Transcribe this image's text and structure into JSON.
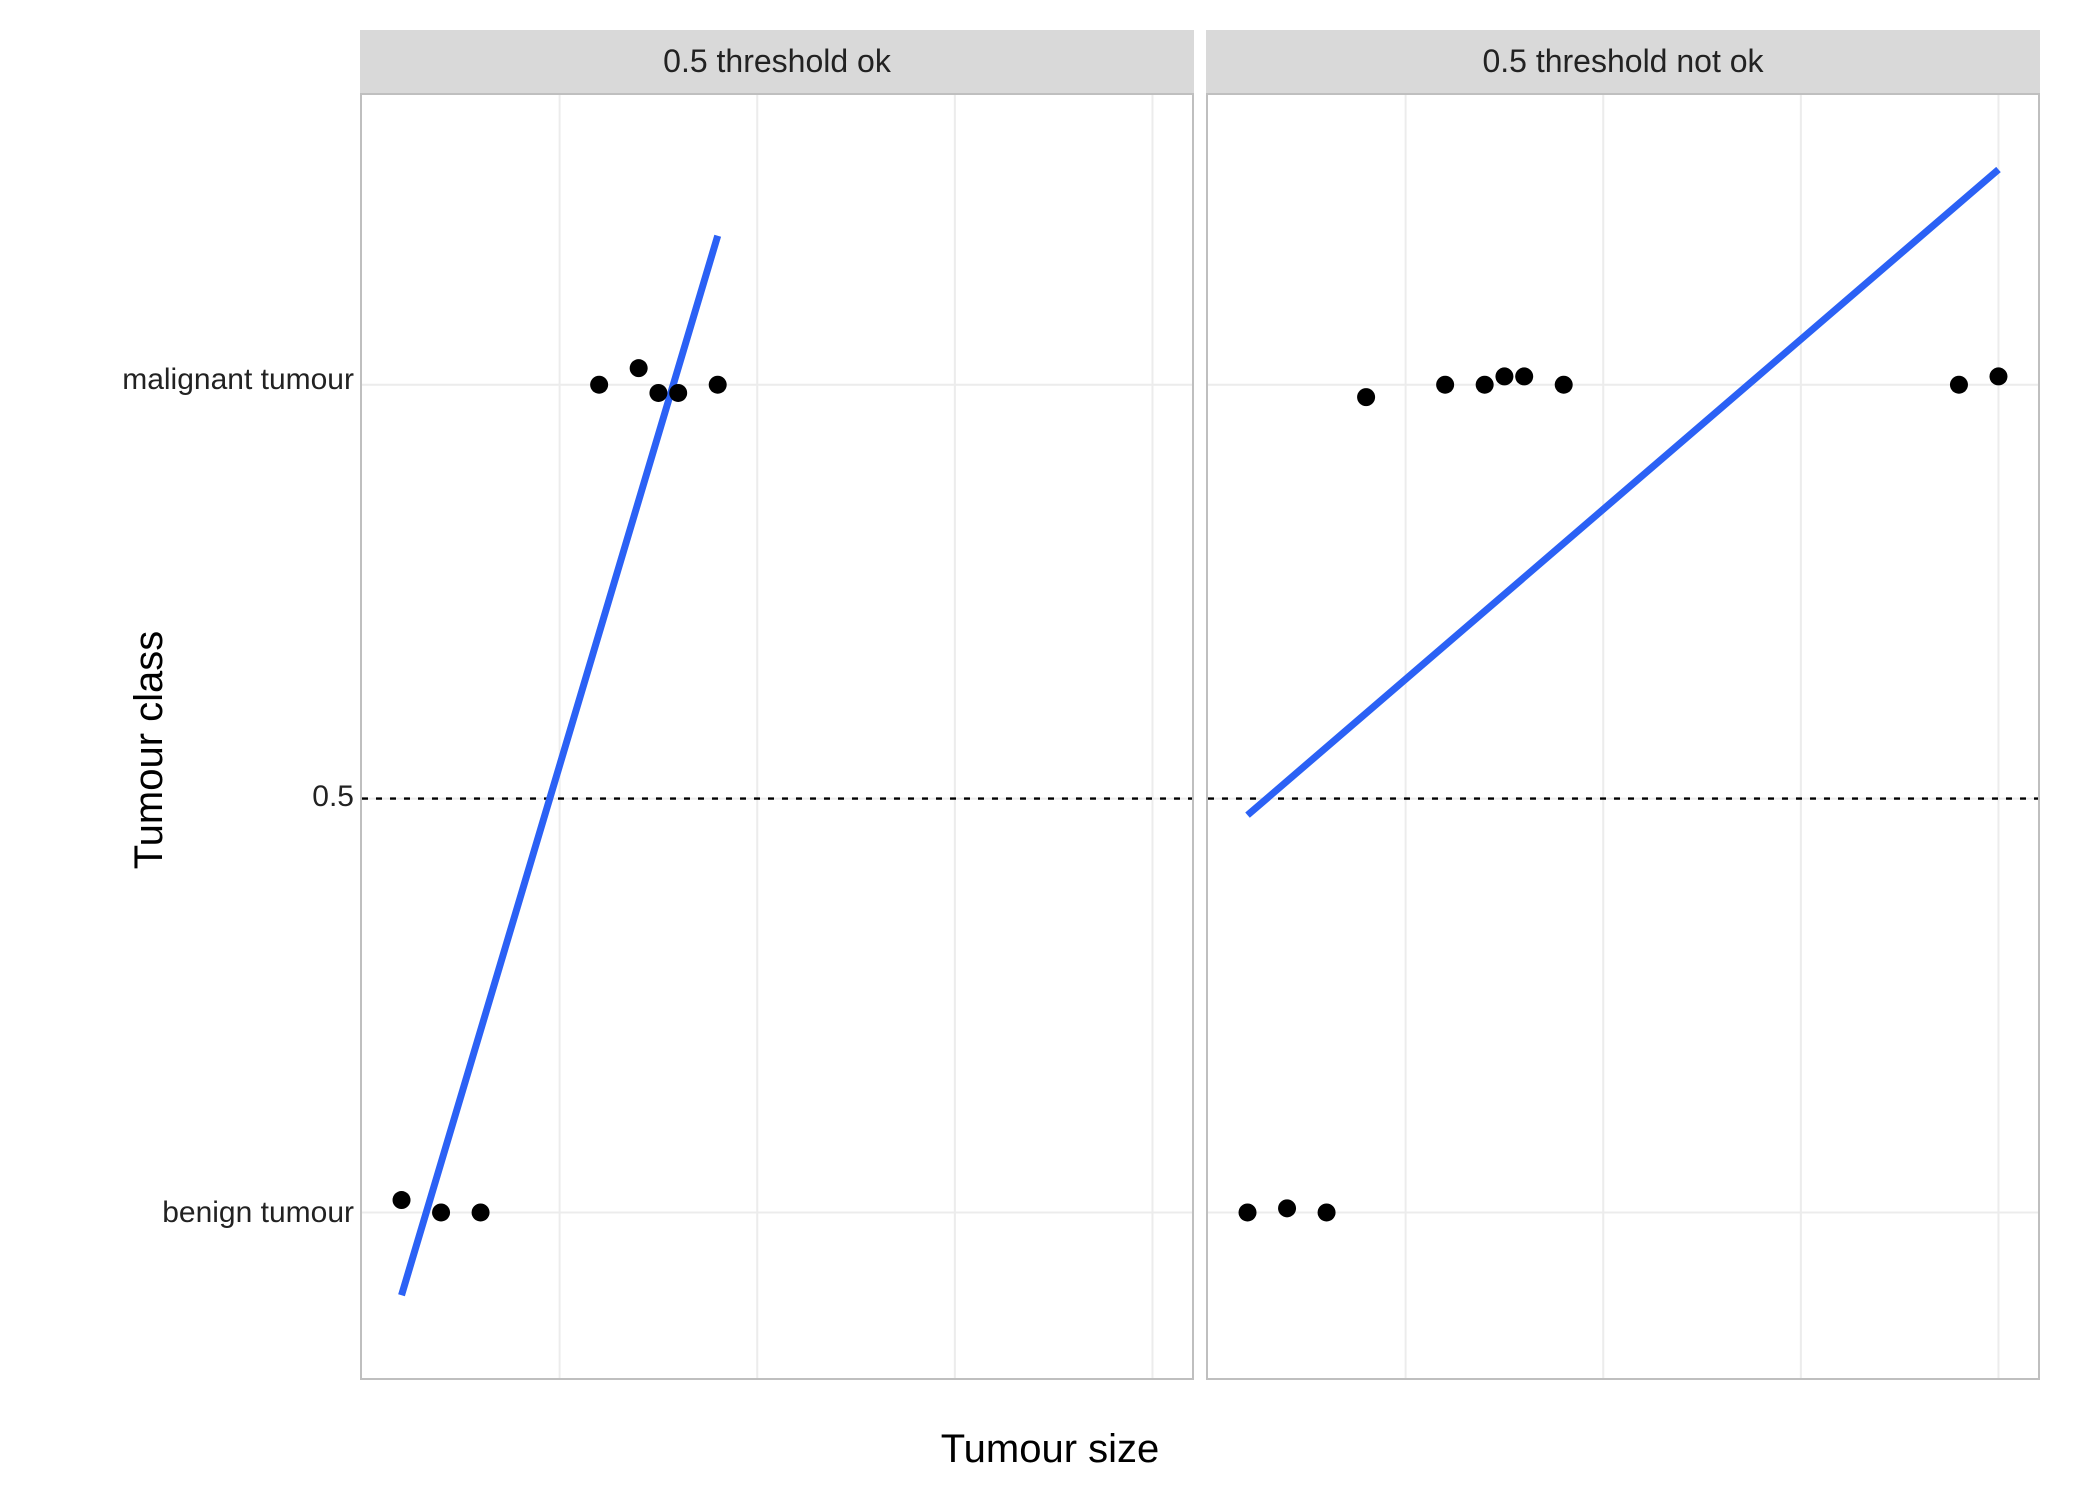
{
  "chart_data": [
    {
      "type": "scatter",
      "facet_label": "0.5 threshold ok",
      "xlim": [
        0,
        21
      ],
      "ylim": [
        -0.2,
        1.35
      ],
      "x_ticks": [
        5,
        10,
        15,
        20
      ],
      "y_ticks_numeric": [
        0,
        0.5,
        1
      ],
      "y_ticks_labels": [
        "benign tumour",
        "0.5",
        "malignant tumour"
      ],
      "threshold_y": 0.5,
      "points": [
        {
          "x": 1,
          "y": 0.015
        },
        {
          "x": 2,
          "y": 0.0
        },
        {
          "x": 3,
          "y": 0.0
        },
        {
          "x": 6,
          "y": 1.0
        },
        {
          "x": 7,
          "y": 1.02
        },
        {
          "x": 7.5,
          "y": 0.99
        },
        {
          "x": 8,
          "y": 0.99
        },
        {
          "x": 9,
          "y": 1.0
        }
      ],
      "regression_line": {
        "x1": 1,
        "y1": -0.1,
        "x2": 9,
        "y2": 1.18
      }
    },
    {
      "type": "scatter",
      "facet_label": "0.5 threshold not ok",
      "xlim": [
        0,
        21
      ],
      "ylim": [
        -0.2,
        1.35
      ],
      "x_ticks": [
        5,
        10,
        15,
        20
      ],
      "y_ticks_numeric": [
        0,
        0.5,
        1
      ],
      "y_ticks_labels": [
        "benign tumour",
        "0.5",
        "malignant tumour"
      ],
      "threshold_y": 0.5,
      "points": [
        {
          "x": 1,
          "y": 0.0
        },
        {
          "x": 2,
          "y": 0.005
        },
        {
          "x": 3,
          "y": 0.0
        },
        {
          "x": 4,
          "y": 0.985
        },
        {
          "x": 6,
          "y": 1.0
        },
        {
          "x": 7,
          "y": 1.0
        },
        {
          "x": 7.5,
          "y": 1.01
        },
        {
          "x": 8,
          "y": 1.01
        },
        {
          "x": 9,
          "y": 1.0
        },
        {
          "x": 19,
          "y": 1.0
        },
        {
          "x": 20,
          "y": 1.01
        }
      ],
      "regression_line": {
        "x1": 1,
        "y1": 0.48,
        "x2": 20,
        "y2": 1.26
      }
    }
  ],
  "axes": {
    "xlabel": "Tumour size",
    "ylabel": "Tumour class"
  },
  "colors": {
    "line": "#2b61f5",
    "grid": "#ececec",
    "strip_bg": "#d9d9d9"
  }
}
